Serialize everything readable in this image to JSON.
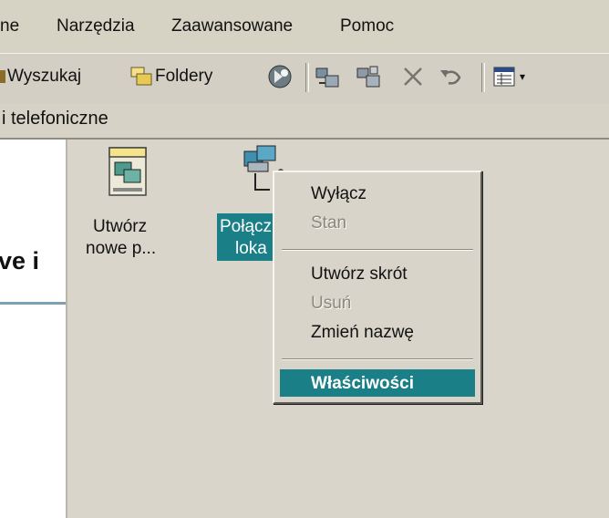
{
  "menubar": {
    "items": [
      {
        "label": "ne"
      },
      {
        "label": "Narzędzia"
      },
      {
        "label": "Zaawansowane"
      },
      {
        "label": "Pomoc"
      }
    ]
  },
  "toolbar": {
    "search_label": "Wyszukaj",
    "folders_label": "Foldery"
  },
  "address": {
    "text": "i telefoniczne"
  },
  "leftpane": {
    "title": "ve i"
  },
  "icons": [
    {
      "line1": "Utwórz",
      "line2": "nowe p..."
    },
    {
      "line1": "Połącz",
      "line2": "loka"
    }
  ],
  "context_menu": {
    "items": [
      {
        "label": "Wyłącz",
        "enabled": true
      },
      {
        "label": "Stan",
        "enabled": false
      },
      {
        "label": "Utwórz skrót",
        "enabled": true
      },
      {
        "label": "Usuń",
        "enabled": false
      },
      {
        "label": "Zmień nazwę",
        "enabled": true
      },
      {
        "label": "Właściwości",
        "enabled": true,
        "selected": true
      }
    ]
  },
  "colors": {
    "selection": "#1a7f86",
    "face": "#d8d4c9"
  }
}
